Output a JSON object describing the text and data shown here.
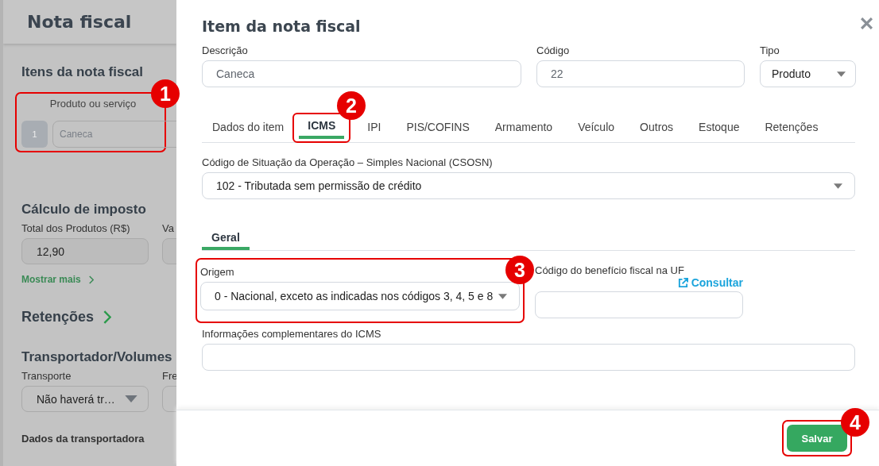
{
  "background_page": {
    "title": "Nota fiscal",
    "items_section": {
      "heading": "Itens da nota fiscal",
      "highlighted": true,
      "column_label": "Produto ou serviço",
      "rows": [
        {
          "number": "1",
          "product": "Caneca"
        }
      ]
    },
    "tax_section": {
      "heading": "Cálculo de imposto",
      "fields": [
        {
          "label": "Total dos Produtos (R$)",
          "value": "12,90"
        },
        {
          "label": "Va"
        }
      ],
      "show_more": "Mostrar mais"
    },
    "retentions": {
      "heading": "Retenções"
    },
    "transport_section": {
      "heading": "Transportador/Volumes",
      "fields": [
        {
          "label": "Transporte",
          "value": "Não haverá tr…",
          "kind": "select"
        },
        {
          "label": "Fre",
          "kind": "select"
        }
      ],
      "subheading": "Dados da transportadora"
    }
  },
  "dialog": {
    "title": "Item da nota fiscal",
    "fields": [
      {
        "label": "Descrição",
        "kind": "text",
        "value": "Caneca"
      },
      {
        "label": "Código",
        "kind": "text",
        "value": "22"
      },
      {
        "label": "Tipo",
        "kind": "select",
        "value": "Produto"
      }
    ],
    "tabs": [
      {
        "label": "Dados do item",
        "selected": false,
        "highlighted": false
      },
      {
        "label": "ICMS",
        "selected": true,
        "highlighted": true
      },
      {
        "label": "IPI",
        "selected": false,
        "highlighted": false
      },
      {
        "label": "PIS/COFINS",
        "selected": false,
        "highlighted": false
      },
      {
        "label": "Armamento",
        "selected": false,
        "highlighted": false
      },
      {
        "label": "Veículo",
        "selected": false,
        "highlighted": false
      },
      {
        "label": "Outros",
        "selected": false,
        "highlighted": false
      },
      {
        "label": "Estoque",
        "selected": false,
        "highlighted": false
      },
      {
        "label": "Retenções",
        "selected": false,
        "highlighted": false
      }
    ],
    "csosn": {
      "label": "Código de Situação da Operação – Simples Nacional (CSOSN)",
      "value": "102 - Tributada sem permissão de crédito"
    },
    "subtabs": [
      {
        "label": "Geral",
        "selected": true
      }
    ],
    "origem": {
      "label": "Origem",
      "value": "0 - Nacional, exceto as indicadas nos códigos 3, 4, 5 e 8",
      "highlighted": true
    },
    "beneficio": {
      "label": "Código do benefício fiscal na UF",
      "link": "Consultar"
    },
    "info": {
      "label": "Informações complementares do ICMS"
    },
    "save_button": {
      "label": "Salvar",
      "highlighted": true
    }
  },
  "callouts": [
    {
      "number": "1"
    },
    {
      "number": "2"
    },
    {
      "number": "3"
    },
    {
      "number": "4"
    }
  ]
}
